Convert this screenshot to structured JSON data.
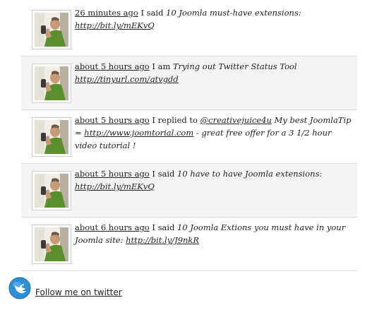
{
  "tweets": [
    {
      "time": "26 minutes ago",
      "prefix": " I said ",
      "text": "10 Joomla must-have extensions: ",
      "url": "http://bit.ly/mEKvQ",
      "trailing": ""
    },
    {
      "time": "about 5 hours ago",
      "prefix": " I am ",
      "text": "Trying out Twitter Status Tool ",
      "url": "http://tinyurl.com/qtvgdd",
      "trailing": ""
    },
    {
      "time": "about 5 hours ago",
      "prefix": " I replied to ",
      "mention": "@creativejuice4u",
      "text": " My best JoomlaTip = ",
      "url": "http://www.joomtorial.com",
      "trailing": " - great free offer for a 3 1/2 hour video tutorial !"
    },
    {
      "time": "about 5 hours ago",
      "prefix": " I said ",
      "text": "10 have to have Joomla extensions: ",
      "url": "http://bit.ly/mEKvQ",
      "trailing": ""
    },
    {
      "time": "about 6 hours ago",
      "prefix": " I said ",
      "text": "10 Joomla Extions you must have in your Joomla site: ",
      "url": "http://bit.ly/J9nkR",
      "trailing": ""
    }
  ],
  "footer": {
    "follow_label": "Follow me on twitter",
    "icon": "twitter-bird-icon"
  },
  "colors": {
    "text": "#222222",
    "alt_row": "#f5f5f5",
    "divider": "#dddddd",
    "twitter_blue": "#2b8fd6"
  }
}
